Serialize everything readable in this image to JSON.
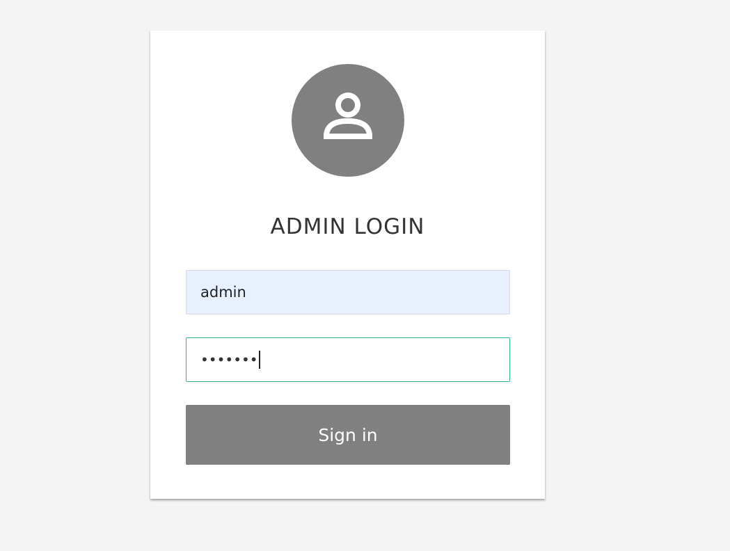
{
  "login": {
    "title": "ADMIN LOGIN",
    "username_value": "admin",
    "password_masked": "•••••••",
    "signin_label": "Sign in",
    "avatar_icon": "user-icon"
  },
  "colors": {
    "background": "#f4f4f4",
    "card": "#ffffff",
    "avatar": "#808080",
    "button": "#808080",
    "username_field_bg": "#e8f0fe",
    "focused_border": "#2db88a"
  }
}
